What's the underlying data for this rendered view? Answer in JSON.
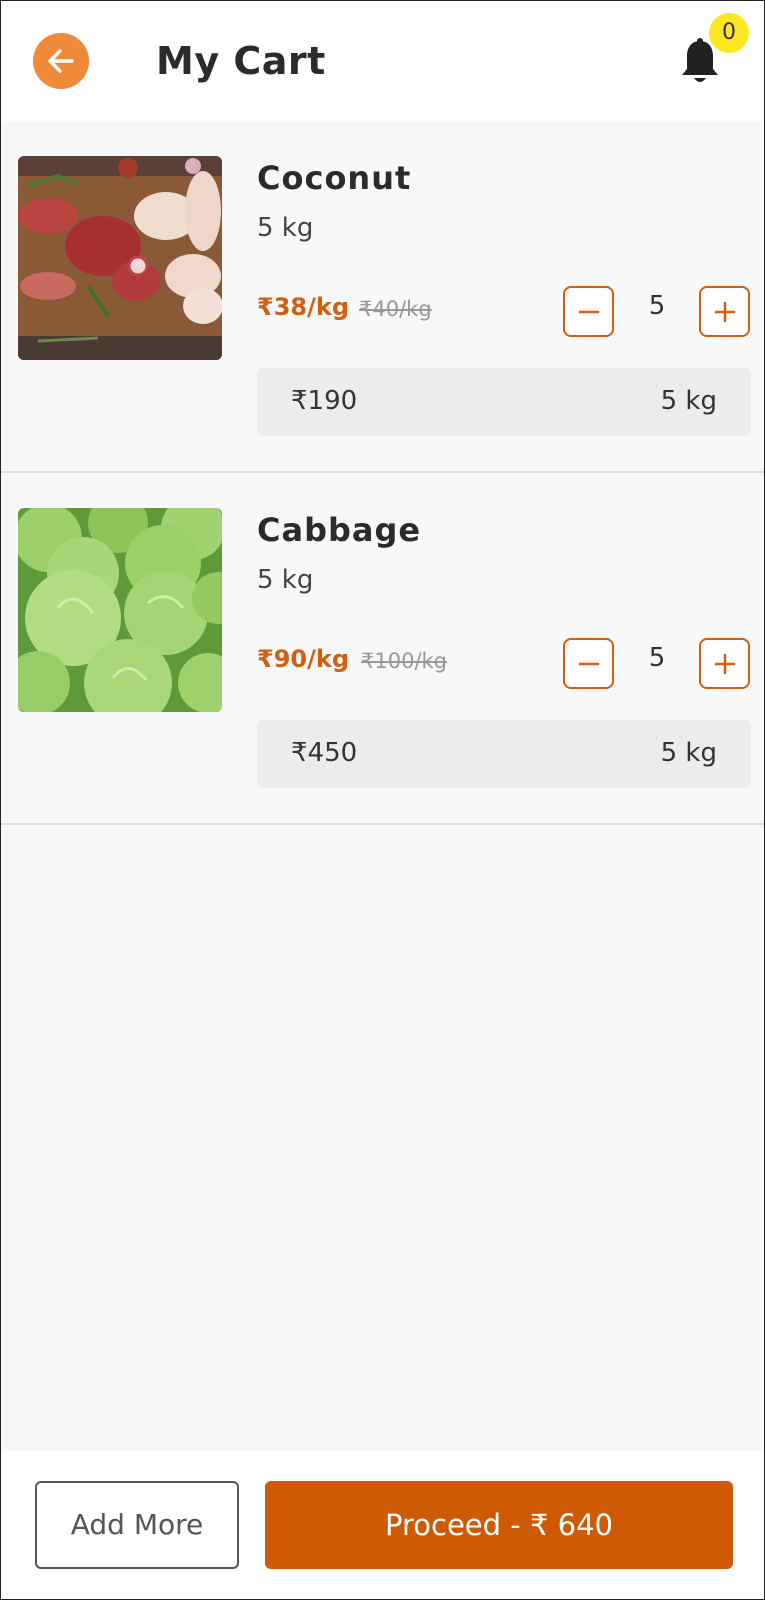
{
  "header": {
    "title": "My Cart",
    "notification_count": "0"
  },
  "cart": {
    "items": [
      {
        "name": "Coconut",
        "unit": "5 kg",
        "price": "₹38/kg",
        "old_price": "₹40/kg",
        "quantity": "5",
        "total_price": "₹190",
        "total_weight": "5 kg",
        "image": "meat-platter"
      },
      {
        "name": "Cabbage",
        "unit": "5 kg",
        "price": "₹90/kg",
        "old_price": "₹100/kg",
        "quantity": "5",
        "total_price": "₹450",
        "total_weight": "5 kg",
        "image": "cabbages"
      }
    ]
  },
  "footer": {
    "add_more_label": "Add More",
    "proceed_label": "Proceed - ₹ 640"
  },
  "colors": {
    "accent": "#cf5a05",
    "back_button": "#ee8a3a",
    "badge": "#fde725"
  }
}
